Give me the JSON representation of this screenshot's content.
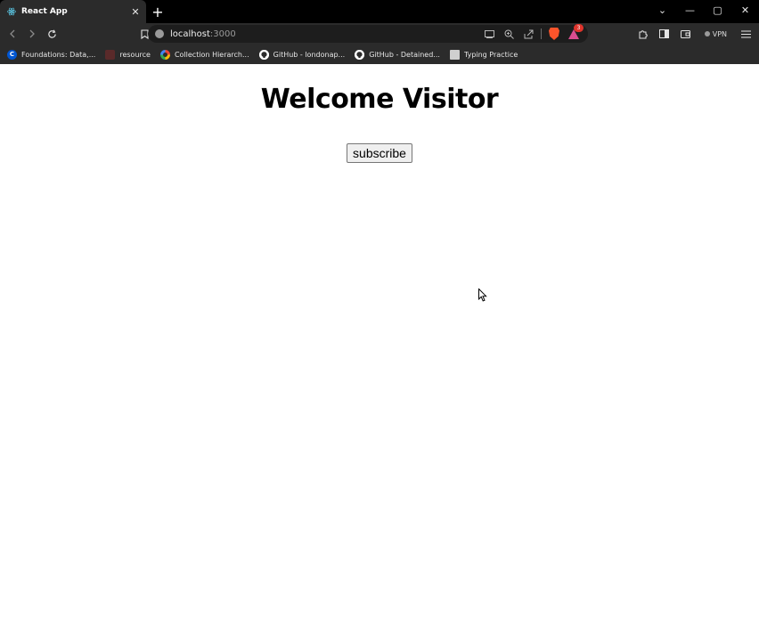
{
  "tab": {
    "title": "React App",
    "close": "✕",
    "new_tab": "+"
  },
  "window_controls": {
    "dropdown": "⌄",
    "minimize": "—",
    "maximize": "▢",
    "close": "✕"
  },
  "address_bar": {
    "host": "localhost",
    "port": ":3000"
  },
  "vpn_label": "VPN",
  "rewards_badge": "3",
  "bookmarks": [
    {
      "label": "Foundations: Data,...",
      "icon": "coursera-icon",
      "glyph": "C"
    },
    {
      "label": "resource",
      "icon": "resource-icon",
      "glyph": ""
    },
    {
      "label": "Collection Hierarch...",
      "icon": "google-icon",
      "glyph": ""
    },
    {
      "label": "GitHub - londonap...",
      "icon": "github-icon",
      "glyph": ""
    },
    {
      "label": "GitHub - Detained...",
      "icon": "github-icon",
      "glyph": ""
    },
    {
      "label": "Typing Practice",
      "icon": "typing-icon",
      "glyph": ""
    }
  ],
  "page": {
    "heading": "Welcome Visitor",
    "subscribe_label": "subscribe"
  },
  "colors": {
    "chrome_bg": "#2b2b2b",
    "tabstrip_bg": "#000000",
    "brave_orange": "#fb542b",
    "page_bg": "#ffffff"
  }
}
